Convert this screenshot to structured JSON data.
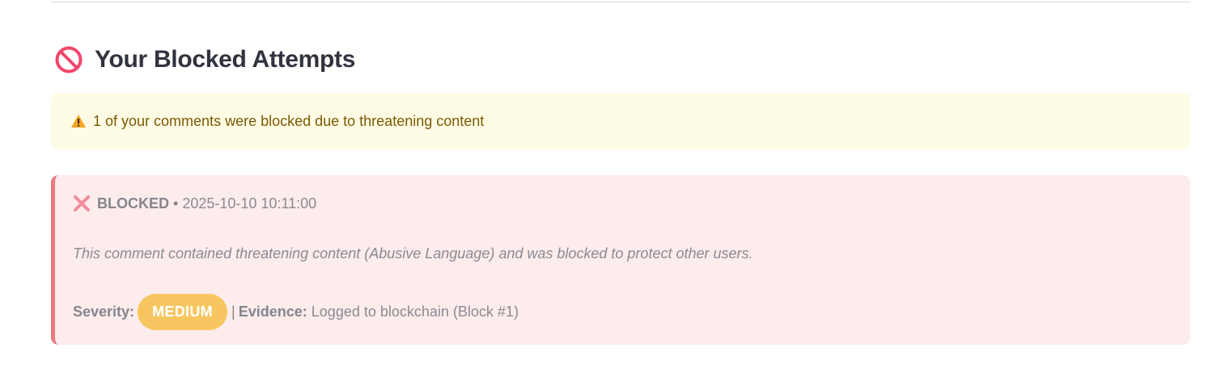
{
  "section": {
    "title": "Your Blocked Attempts",
    "title_icon": "no-entry-icon"
  },
  "warning": {
    "icon": "warning-icon",
    "text": "1 of your comments were blocked due to threatening content",
    "color": "#fffce6"
  },
  "blocked_items": [
    {
      "icon": "cross-mark-icon",
      "status": "BLOCKED",
      "separator": "•",
      "timestamp": "2025-10-10 10:11:00",
      "message": "This comment contained threatening content (Abusive Language) and was blocked to protect other users.",
      "severity_label": "Severity:",
      "severity": "MEDIUM",
      "severity_color": "#f7c660",
      "pipe": "|",
      "evidence_label": "Evidence:",
      "evidence": "Logged to blockchain (Block #1)"
    }
  ],
  "colors": {
    "card_background": "#fdecec",
    "card_accent": "#e9787f",
    "title_icon": "#f2466a"
  }
}
